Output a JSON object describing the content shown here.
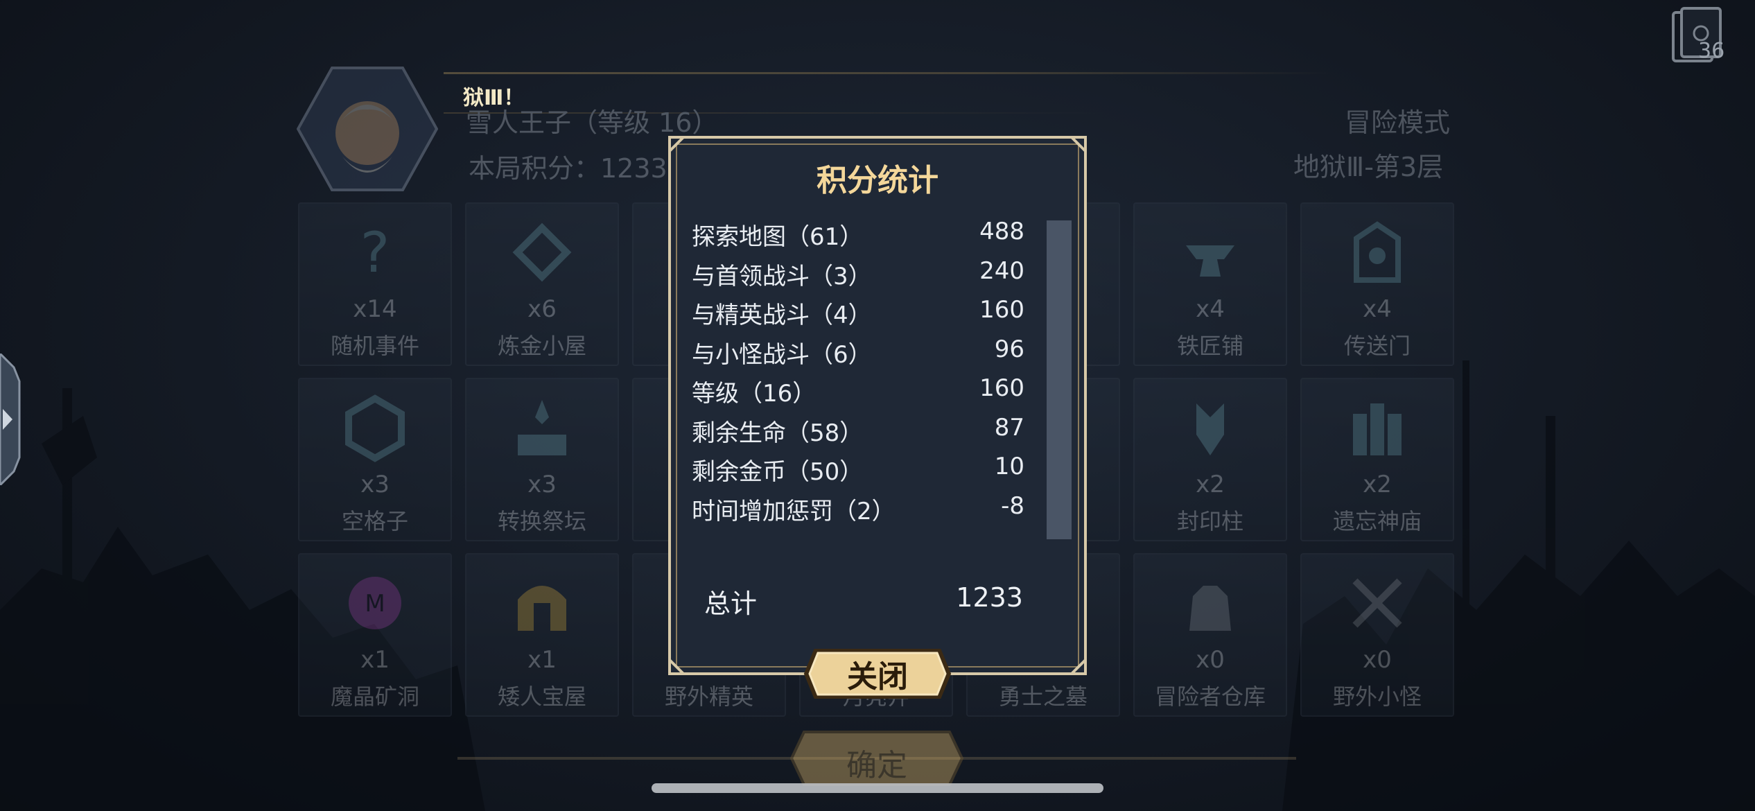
{
  "corner_badge": {
    "count": "36"
  },
  "notice": "狱Ⅲ！",
  "header": {
    "hero_name": "雪人王子（等级 16）",
    "score_label": "本局积分：1233",
    "mode": "冒险模式",
    "floor": "地狱Ⅲ-第3层"
  },
  "grid": [
    {
      "count": "x14",
      "label": "随机事件",
      "icon": "question-icon"
    },
    {
      "count": "x6",
      "label": "炼金小屋",
      "icon": "alchemy-icon"
    },
    {
      "count": "",
      "label": "",
      "icon": "hidden-icon"
    },
    {
      "count": "",
      "label": "",
      "icon": "hidden-icon"
    },
    {
      "count": "",
      "label": "",
      "icon": "hidden-icon"
    },
    {
      "count": "x4",
      "label": "铁匠铺",
      "icon": "anvil-icon"
    },
    {
      "count": "x4",
      "label": "传送门",
      "icon": "portal-icon"
    },
    {
      "count": "x3",
      "label": "空格子",
      "icon": "hexagon-icon"
    },
    {
      "count": "x3",
      "label": "转换祭坛",
      "icon": "altar-icon"
    },
    {
      "count": "",
      "label": "",
      "icon": "hidden-icon"
    },
    {
      "count": "",
      "label": "",
      "icon": "sun-icon"
    },
    {
      "count": "",
      "label": "",
      "icon": "hidden-icon"
    },
    {
      "count": "x2",
      "label": "封印柱",
      "icon": "seal-pillar-icon"
    },
    {
      "count": "x2",
      "label": "遗忘神庙",
      "icon": "temple-icon"
    },
    {
      "count": "x1",
      "label": "魔晶矿洞",
      "icon": "crystal-mine-icon"
    },
    {
      "count": "x1",
      "label": "矮人宝屋",
      "icon": "dwarf-helmet-icon"
    },
    {
      "count": "",
      "label": "野外精英",
      "icon": "elite-icon"
    },
    {
      "count": "",
      "label": "月亮井",
      "icon": "moon-well-icon"
    },
    {
      "count": "",
      "label": "勇士之墓",
      "icon": "tomb-icon"
    },
    {
      "count": "x0",
      "label": "冒险者仓库",
      "icon": "warehouse-icon"
    },
    {
      "count": "x0",
      "label": "野外小怪",
      "icon": "crossed-swords-icon"
    }
  ],
  "confirm_label": "确定",
  "dialog": {
    "title": "积分统计",
    "rows": [
      {
        "name": "探索地图（61）",
        "value": "488"
      },
      {
        "name": "与首领战斗（3）",
        "value": "240"
      },
      {
        "name": "与精英战斗（4）",
        "value": "160"
      },
      {
        "name": "与小怪战斗（6）",
        "value": "96"
      },
      {
        "name": "等级（16）",
        "value": "160"
      },
      {
        "name": "剩余生命（58）",
        "value": "87"
      },
      {
        "name": "剩余金币（50）",
        "value": "10"
      },
      {
        "name": "时间增加惩罚（2）",
        "value": "-8"
      }
    ],
    "total_label": "总计",
    "total_value": "1233",
    "close_label": "关闭"
  },
  "colors": {
    "accent_gold": "#f4d79a",
    "panel_bg": "#1f2836",
    "button_gold": "#e8c98a"
  }
}
